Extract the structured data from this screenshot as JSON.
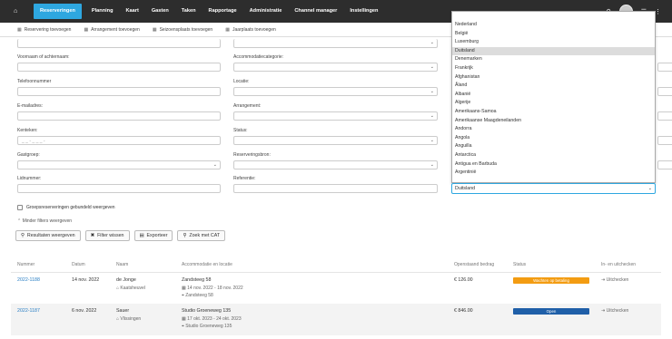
{
  "nav": {
    "home_icon": "home-icon",
    "items": [
      "Reserveringen",
      "Planning",
      "Kaart",
      "Gasten",
      "Taken",
      "Rapportage",
      "Administratie",
      "Channel manager",
      "Instellingen"
    ]
  },
  "toolbar": [
    "Reservering toevoegen",
    "Arrangement toevoegen",
    "Seizoensplaats toevoegen",
    "Jaarplaats toevoegen"
  ],
  "form": {
    "left": [
      {
        "label": "Voornaam of achternaam:",
        "value": "",
        "select": false
      },
      {
        "label": "Telefoonnummer",
        "value": "",
        "select": false
      },
      {
        "label": "E-mailadres:",
        "value": "",
        "select": false
      },
      {
        "label": "Kenteken:",
        "value": "_ _ - _ _ _ -",
        "select": false
      },
      {
        "label": "Gastgroep:",
        "value": "",
        "select": true
      },
      {
        "label": "Lidnummer:",
        "value": "",
        "select": false
      }
    ],
    "right": [
      {
        "label": "Accommodatiecategorie:",
        "value": "",
        "select": true
      },
      {
        "label": "Locatie:",
        "value": "",
        "select": true
      },
      {
        "label": "Arrangement:",
        "value": "",
        "select": true
      },
      {
        "label": "Status:",
        "value": "",
        "select": true
      },
      {
        "label": "Reserveringsbron:",
        "value": "",
        "select": true
      },
      {
        "label": "Referentie:",
        "value": "",
        "select": false
      }
    ],
    "group_checkbox": "Groepsreserveringen gebundeld weergeven",
    "less_filters": "Minder filters weergeven",
    "buttons": [
      "Resultaten weergeven",
      "Filter wissen",
      "Exporteer",
      "Zoek met CAT"
    ]
  },
  "country_dropdown": {
    "options": [
      "Nederland",
      "België",
      "Luxemburg",
      "Duitsland",
      "Denemarken",
      "Frankrijk",
      "Afghanistan",
      "Åland",
      "Albanië",
      "Algerije",
      "Amerikaans-Samoa",
      "Amerikaanse Maagdeneilanden",
      "Andorra",
      "Angola",
      "Anguilla",
      "Antarctica",
      "Antigua en Barbuda",
      "Argentinië"
    ],
    "highlighted": "Duitsland",
    "selected": "Duitsland"
  },
  "table": {
    "headers": [
      "Nummer",
      "Datum",
      "Naam",
      "Accommodatie en locatie",
      "Openstaand bedrag",
      "Status",
      "In- en uitchecken"
    ],
    "rows": [
      {
        "nummer": "2022-1188",
        "datum": "14 nov. 2022",
        "naam": "de Jonge",
        "plaats": "Kaatsheuvel",
        "acc": "Zandsteeg 58",
        "periode": "14 nov. 2022 - 18 nov. 2022",
        "adres": "Zandsteeg 58",
        "bedrag": "€ 126.00",
        "status": "Wachten op betaling",
        "status_color": "#f39c12",
        "actie": "Uitchecken"
      },
      {
        "nummer": "2022-1187",
        "datum": "6 nov. 2022",
        "naam": "Sauer",
        "plaats": "Vlissingen",
        "acc": "Studio Groeneweg 135",
        "periode": "17 okt. 2023 - 24 okt. 2023",
        "adres": "Studio Groeneweg 135",
        "bedrag": "€ 846.00",
        "status": "Open",
        "status_color": "#1f5fa8",
        "actie": "Uitchecken"
      }
    ]
  }
}
